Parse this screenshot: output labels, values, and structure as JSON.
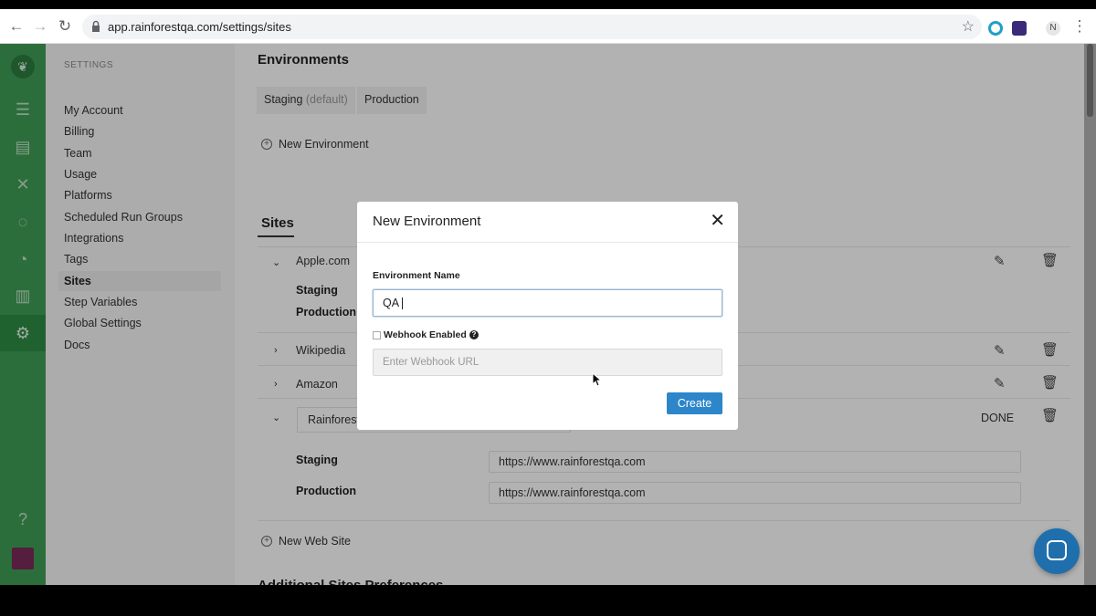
{
  "browser": {
    "url": "app.rainforestqa.com/settings/sites",
    "profile_initial": "N"
  },
  "settings": {
    "heading": "SETTINGS",
    "items": [
      "My Account",
      "Billing",
      "Team",
      "Usage",
      "Platforms",
      "Scheduled Run Groups",
      "Integrations",
      "Tags",
      "Sites",
      "Step Variables",
      "Global Settings",
      "Docs"
    ],
    "selected": "Sites"
  },
  "environments": {
    "title": "Environments",
    "tabs": [
      {
        "label": "Staging",
        "suffix": "(default)"
      },
      {
        "label": "Production"
      }
    ],
    "new_label": "New Environment"
  },
  "sites": {
    "title": "Sites",
    "rows": [
      {
        "name": "Apple.com",
        "expanded": true,
        "envs": [
          "Staging",
          "Production"
        ]
      },
      {
        "name": "Wikipedia",
        "expanded": false
      },
      {
        "name": "Amazon",
        "expanded": false
      },
      {
        "name": "Rainforest",
        "expanded": true,
        "editing": true,
        "done_label": "DONE",
        "envs": [
          {
            "name": "Staging",
            "url": "https://www.rainforestqa.com"
          },
          {
            "name": "Production",
            "url": "https://www.rainforestqa.com"
          }
        ]
      }
    ],
    "new_label": "New Web Site",
    "next_section": "Additional Sites Preferences"
  },
  "modal": {
    "title": "New Environment",
    "env_name_label": "Environment Name",
    "env_name_value": "QA",
    "webhook_label": "Webhook Enabled",
    "webhook_checked": false,
    "webhook_placeholder": "Enter Webhook URL",
    "create_label": "Create"
  },
  "colors": {
    "leftnav": "#3f9e55",
    "primary_button": "#2d86c9",
    "chat_bubble": "#1f6fad"
  }
}
